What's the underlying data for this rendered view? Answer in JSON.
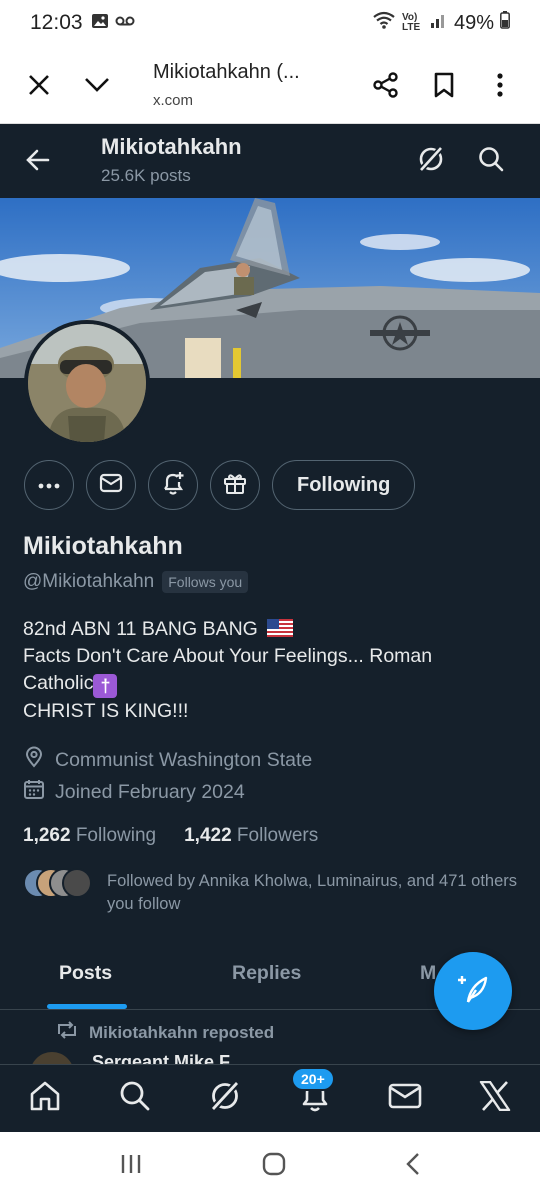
{
  "status_bar": {
    "time": "12:03",
    "battery": "49%",
    "network": "Vo) LTE"
  },
  "browser": {
    "title": "Mikiotahkahn (...",
    "url": "x.com"
  },
  "header": {
    "name": "Mikiotahkahn",
    "posts": "25.6K posts"
  },
  "profile": {
    "display_name": "Mikiotahkahn",
    "handle": "@Mikiotahkahn",
    "follows_you": "Follows you",
    "follow_button": "Following",
    "bio": [
      "82nd ABN 11 BANG BANG",
      "Facts Don't Care About Your Feelings... Roman",
      "Catholic",
      "CHRIST IS KING!!!"
    ],
    "location": "Communist Washington State",
    "joined": "Joined February 2024",
    "following_count": "1,262",
    "following_label": "Following",
    "followers_count": "1,422",
    "followers_label": "Followers",
    "followed_by": "Followed by Annika Kholwa, Luminairus, and 471 others you follow"
  },
  "tabs": [
    {
      "label": "Posts",
      "active": true
    },
    {
      "label": "Replies",
      "active": false
    },
    {
      "label": "M",
      "active": false
    }
  ],
  "timeline": {
    "repost_label": "Mikiotahkahn reposted",
    "peek_name": "Sergeant Mike F..."
  },
  "bottom_nav": {
    "notifications_badge": "20+"
  },
  "colors": {
    "background": "#15202b",
    "accent": "#1d9bf0",
    "text": "#e7e9ea",
    "muted": "#8b98a5"
  }
}
